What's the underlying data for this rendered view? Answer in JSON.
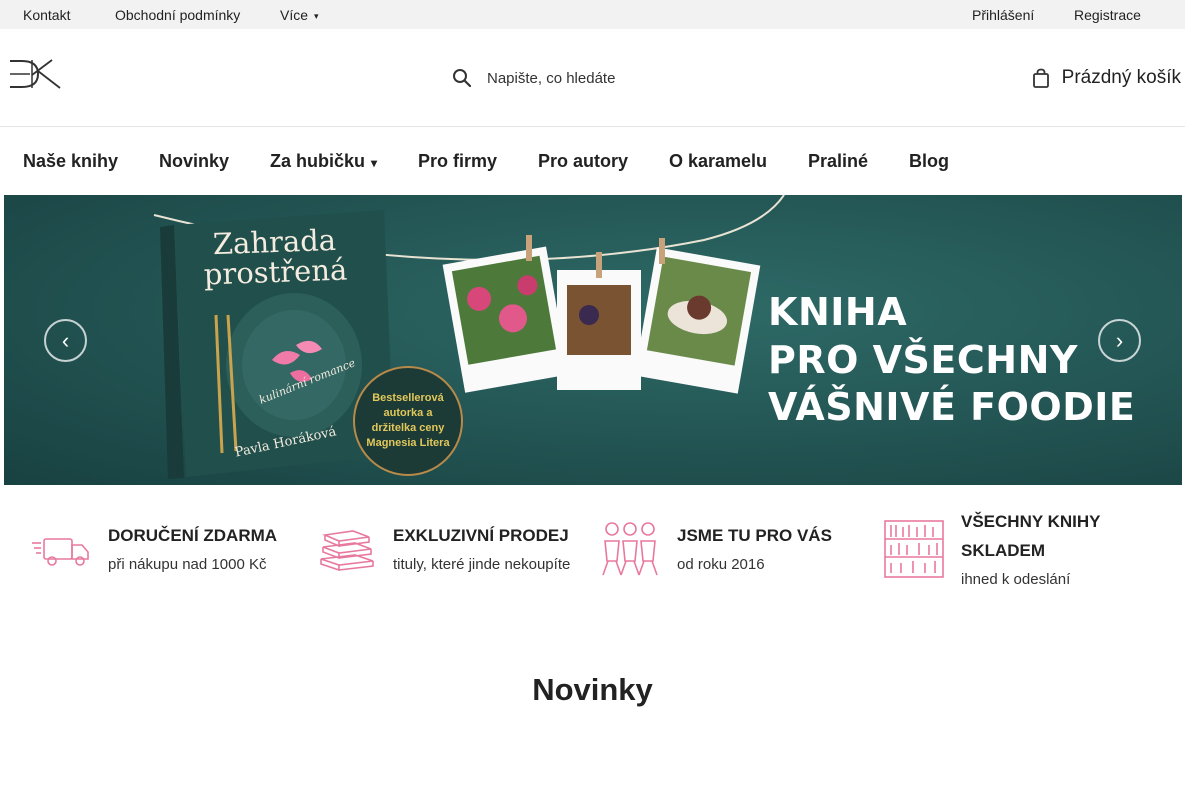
{
  "topbar": {
    "links": [
      "Kontakt",
      "Obchodní podmínky",
      "Více"
    ],
    "more_caret": "▾",
    "login": "Přihlášení",
    "register": "Registrace"
  },
  "header": {
    "logo_text": "DK",
    "search_placeholder": "Napište, co hledáte",
    "cart_label": "Prázdný košík"
  },
  "nav": {
    "items": [
      "Naše knihy",
      "Novinky",
      "Za hubičku",
      "Pro firmy",
      "Pro autory",
      "O karamelu",
      "Praliné",
      "Blog"
    ],
    "dropdown_caret": "▾"
  },
  "banner": {
    "book_title": "Zahrada prostřená",
    "book_subtitle": "kulinární romance",
    "book_author": "Pavla Horáková",
    "badge_text": "Bestsellerová autorka a držitelka ceny Magnesia Litera",
    "headline_lines": [
      "KNIHA",
      "PRO VŠECHNY",
      "VÁŠNIVÉ FOODIE"
    ],
    "prev_arrow": "‹",
    "next_arrow": "›"
  },
  "features": [
    {
      "icon": "delivery-truck-icon",
      "title": "DORUČENÍ ZDARMA",
      "subtitle": "při nákupu nad 1000 Kč"
    },
    {
      "icon": "books-stack-icon",
      "title": "EXKLUZIVNÍ PRODEJ",
      "subtitle": "tituly, které jinde nekoupíte"
    },
    {
      "icon": "team-icon",
      "title": "JSME TU PRO VÁS",
      "subtitle": "od roku 2016"
    },
    {
      "icon": "bookshelf-icon",
      "title": "VŠECHNY KNIHY SKLADEM",
      "subtitle": "ihned k odeslání"
    }
  ],
  "section": {
    "title": "Novinky"
  },
  "colors": {
    "accent_pink": "#e8799e",
    "banner_bg": "#1f4d4d",
    "badge_gold": "#e2c85a"
  }
}
